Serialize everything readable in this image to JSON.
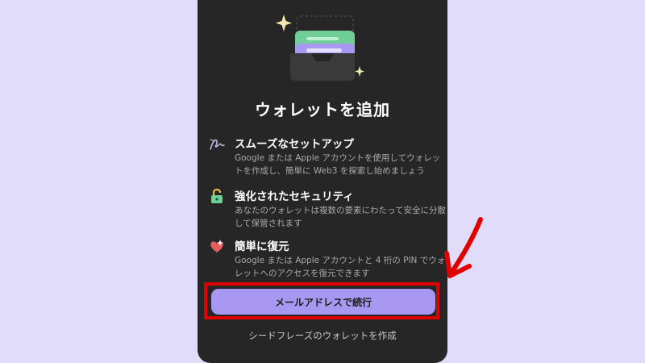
{
  "dialog": {
    "title": "ウォレットを追加",
    "features": [
      {
        "icon": "signature-icon",
        "title": "スムーズなセットアップ",
        "description": "Google または Apple アカウントを使用してウォレットを作成し、簡単に Web3 を探索し始めましょう"
      },
      {
        "icon": "lock-icon",
        "title": "強化されたセキュリティ",
        "description": "あなたのウォレットは複数の要素にわたって安全に分散して保管されます"
      },
      {
        "icon": "heart-sparkle-icon",
        "title": "簡単に復元",
        "description": "Google または Apple アカウントと 4 桁の PIN でウォレットへのアクセスを復元できます"
      }
    ],
    "primary_button_label": "メールアドレスで続行",
    "secondary_link_label": "シードフレーズのウォレットを作成"
  },
  "colors": {
    "page_background": "#e2dcfb",
    "panel_background": "#262626",
    "primary_button": "#a998f2",
    "highlight": "#e00000"
  }
}
